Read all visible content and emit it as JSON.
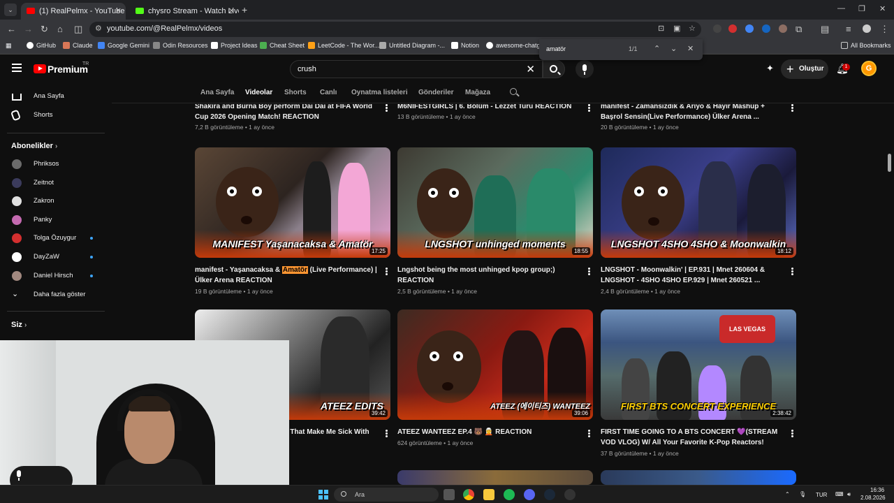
{
  "browser": {
    "tabs": [
      {
        "title": "(1) RealPelmx - YouTube",
        "active": true
      },
      {
        "title": "chysro Stream - Watch Live on",
        "active": false
      }
    ],
    "url": "youtube.com/@RealPelmx/videos",
    "bookmarks": [
      "GitHub",
      "Claude",
      "Google Gemini",
      "Odin Resources",
      "Project Ideas",
      "Cheat Sheet",
      "LeetCode - The Wor...",
      "Untitled Diagram -...",
      "Notion",
      "awesome-chatgp"
    ],
    "all_bookmarks": "All Bookmarks",
    "find": {
      "query": "amatör",
      "count": "1/1"
    }
  },
  "header": {
    "logo": "Premium",
    "country": "TR",
    "search_value": "crush",
    "create_label": "Oluştur",
    "notif_count": "1",
    "avatar_letter": "G"
  },
  "sidebar": {
    "main": [
      {
        "label": "Ana Sayfa",
        "icon": "home-icon"
      },
      {
        "label": "Shorts",
        "icon": "shorts-icon"
      }
    ],
    "subs_title": "Abonelikler",
    "subs": [
      {
        "label": "Phriksos",
        "color": "#6b6b6b",
        "dot": false
      },
      {
        "label": "Zeitnot",
        "color": "#3b3b5c",
        "dot": false
      },
      {
        "label": "Zakron",
        "color": "#e0e0e0",
        "dot": false
      },
      {
        "label": "Panky",
        "color": "#c46ab0",
        "dot": false
      },
      {
        "label": "Tolga Özuygur",
        "color": "#d32f2f",
        "dot": true
      },
      {
        "label": "DayZaW",
        "color": "#ffffff",
        "dot": true
      },
      {
        "label": "Daniel Hirsch",
        "color": "#a1887f",
        "dot": true
      }
    ],
    "more_label": "Daha fazla göster",
    "you_title": "Siz"
  },
  "channel_tabs": [
    "Ana Sayfa",
    "Videolar",
    "Shorts",
    "Canlı",
    "Oynatma listeleri",
    "Gönderiler",
    "Mağaza"
  ],
  "active_tab": "Videolar",
  "row0": [
    {
      "title": "Shakira and Burna Boy perform Dai Dai at FIFA World Cup 2026 Opening Match! REACTION",
      "views": "7,2 B görüntüleme",
      "age": "1 ay önce"
    },
    {
      "title": "M6NIFESTGIRLS | 6. Bölüm - Lezzet Turu REACTION",
      "views": "13 B görüntüleme",
      "age": "1 ay önce"
    },
    {
      "title": "manifest - Zamansızdık & Arıyo & Hayır Mashup + Başrol Sensin(Live Performance) Ülker Arena ...",
      "views": "20 B görüntüleme",
      "age": "1 ay önce"
    }
  ],
  "row1": [
    {
      "title_pre": "manifest - Yaşanacaksa & ",
      "title_hl": "Amatör",
      "title_post": " (Live Performance) | Ülker Arena REACTION",
      "caption": "MANIFEST Yaşanacaksa & Amatör",
      "duration": "17:25",
      "views": "19 B görüntüleme",
      "age": "1 ay önce"
    },
    {
      "title": "Lngshot being the most unhinged kpop group;) REACTION",
      "caption": "LNGSHOT unhinged moments",
      "duration": "18:55",
      "views": "2,5 B görüntüleme",
      "age": "1 ay önce"
    },
    {
      "title": "LNGSHOT - Moonwalkin' | EP.931 | Mnet 260604 & LNGSHOT - 4SHO 4SHO EP.929 | Mnet 260521 ...",
      "caption": "LNGSHOT 4SHO 4SHO & Moonwalkin",
      "duration": "18:12",
      "views": "2,4 B görüntüleme",
      "age": "1 ay önce"
    }
  ],
  "row2": [
    {
      "title": "s That Make Me Sick With",
      "caption": "ATEEZ EDITS",
      "duration": "39:42"
    },
    {
      "title": "ATEEZ WANTEEZ EP.4 🐻 🧝 REACTION",
      "caption": "ATEEZ (에이티즈) WANTEEZ",
      "duration": "39:06",
      "views": "624 görüntüleme",
      "age": "1 ay önce"
    },
    {
      "title": "FIRST TIME GOING TO A BTS CONCERT 💜(STREAM VOD VLOG) W/ All Your Favorite K-Pop Reactors!",
      "caption": "FIRST BTS CONCERT EXPERIENCE",
      "duration": "2:38:42",
      "views": "37 B görüntüleme",
      "age": "1 ay önce"
    }
  ],
  "taskbar": {
    "search": "Ara",
    "lang": "TUR",
    "time": "16:36",
    "date": "2.08.2026"
  }
}
